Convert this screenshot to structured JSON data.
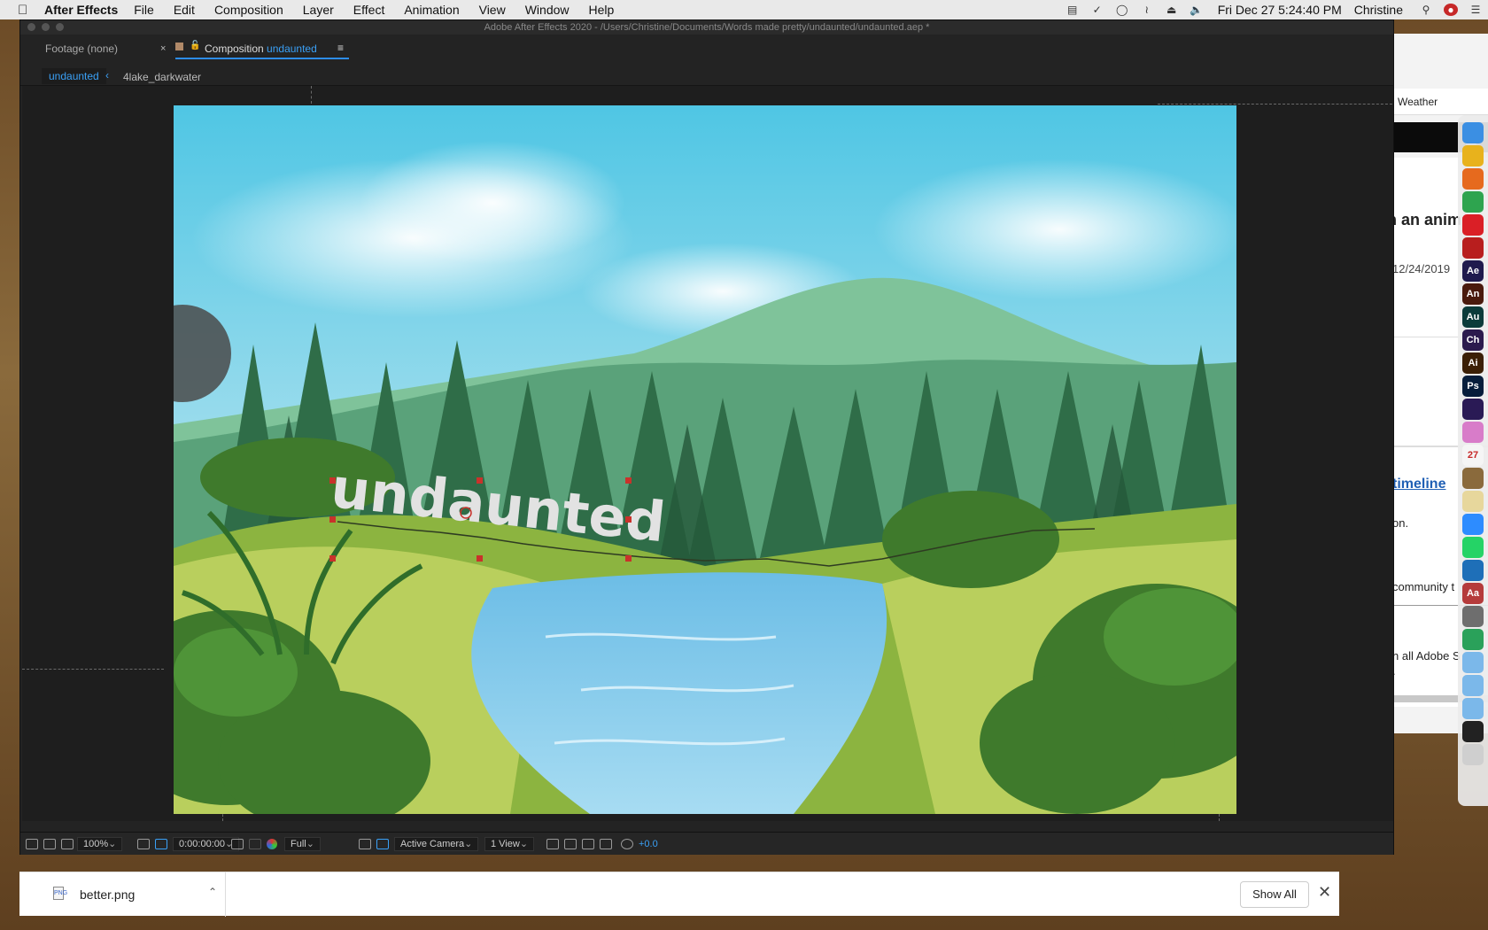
{
  "menubar": {
    "app_name": "After Effects",
    "menus": [
      "File",
      "Edit",
      "Composition",
      "Layer",
      "Effect",
      "Animation",
      "View",
      "Window",
      "Help"
    ],
    "clock": "Fri Dec 27  5:24:40 PM",
    "user": "Christine"
  },
  "ae": {
    "window_title": "Adobe After Effects 2020 - /Users/Christine/Documents/Words made pretty/undaunted/undaunted.aep *",
    "tab_footage": "Footage (none)",
    "tab_close": "×",
    "tab_comp_prefix": "Composition",
    "tab_comp_name": "undaunted",
    "tab_menu": "≡",
    "breadcrumb_active": "undaunted",
    "breadcrumb_next": "4lake_darkwater",
    "canvas_text": "undaunted",
    "footer": {
      "zoom": "100%",
      "timecode": "0:00:00:00",
      "resolution": "Full",
      "camera": "Active Camera",
      "views": "1 View",
      "exposure": "+0.0"
    }
  },
  "browser": {
    "weather": "Weather",
    "heading": "n an anim",
    "date": "12/24/2019",
    "link": "timeline",
    "line1": "on.",
    "line2": "community t",
    "line3": "n all Adobe S",
    "line4": "."
  },
  "dock": {
    "items": [
      {
        "name": "finder",
        "label": "",
        "color": "#3b8fe3"
      },
      {
        "name": "chrome",
        "label": "",
        "color": "#e8b21c"
      },
      {
        "name": "firefox",
        "label": "",
        "color": "#e66a1e"
      },
      {
        "name": "evernote",
        "label": "",
        "color": "#2ea44f"
      },
      {
        "name": "creative-cloud",
        "label": "",
        "color": "#da1f26"
      },
      {
        "name": "acrobat",
        "label": "",
        "color": "#b81e1e"
      },
      {
        "name": "after-effects",
        "label": "Ae",
        "color": "#1f1a4d"
      },
      {
        "name": "animate",
        "label": "An",
        "color": "#4a1a0d"
      },
      {
        "name": "audition",
        "label": "Au",
        "color": "#0b3b3a"
      },
      {
        "name": "character-animator",
        "label": "Ch",
        "color": "#2b1a4d"
      },
      {
        "name": "illustrator",
        "label": "Ai",
        "color": "#3b1f06"
      },
      {
        "name": "photoshop",
        "label": "Ps",
        "color": "#061d3b"
      },
      {
        "name": "premiere",
        "label": "",
        "color": "#2a1a55"
      },
      {
        "name": "photos",
        "label": "",
        "color": "#d87cc9"
      },
      {
        "name": "calendar",
        "label": "27",
        "color": "#f5f5f5"
      },
      {
        "name": "script-editor",
        "label": "",
        "color": "#8a6a3c"
      },
      {
        "name": "textedit",
        "label": "",
        "color": "#e7d79c"
      },
      {
        "name": "zoom",
        "label": "",
        "color": "#2d8cff"
      },
      {
        "name": "whatsapp",
        "label": "",
        "color": "#25d366"
      },
      {
        "name": "preview-app",
        "label": "",
        "color": "#1e6fb8"
      },
      {
        "name": "dictionary",
        "label": "Aa",
        "color": "#b53b3b"
      },
      {
        "name": "clipboard",
        "label": "",
        "color": "#6e6e6e"
      },
      {
        "name": "system-prefs",
        "label": "",
        "color": "#2aa15a"
      },
      {
        "name": "folder-1",
        "label": "",
        "color": "#7bb8ea"
      },
      {
        "name": "folder-2",
        "label": "",
        "color": "#7bb8ea"
      },
      {
        "name": "folder-3",
        "label": "",
        "color": "#7bb8ea"
      },
      {
        "name": "terminal-app",
        "label": "",
        "color": "#222222"
      },
      {
        "name": "trash",
        "label": "",
        "color": "#cfcfcf"
      }
    ]
  },
  "download": {
    "file_name": "better.png",
    "file_badge": "PNG",
    "show_all": "Show All",
    "close": "✕"
  }
}
